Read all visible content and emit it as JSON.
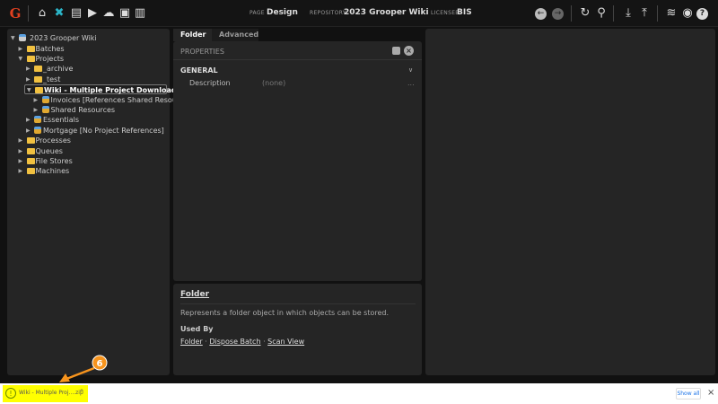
{
  "header": {
    "page_label": "PAGE",
    "page": "Design",
    "repo_label": "REPOSITORY",
    "repo": "2023 Grooper Wiki",
    "licensee_label": "LICENSEE",
    "licensee": "BIS",
    "icons": [
      "grooper-logo-icon",
      "home-icon",
      "design-tools-icon",
      "batches-icon",
      "tasks-icon",
      "cloud-upload-icon",
      "jobs-icon",
      "stats-icon",
      "back-icon",
      "forward-icon",
      "refresh-icon",
      "search-icon",
      "download-icon",
      "upload-icon",
      "database-icon",
      "user-icon",
      "help-icon"
    ]
  },
  "tree": {
    "root": "2023 Grooper Wiki",
    "items": [
      {
        "label": "Batches"
      },
      {
        "label": "Projects"
      },
      {
        "label": "_archive"
      },
      {
        "label": "_test"
      },
      {
        "label": "Wiki - Multiple Project Download"
      },
      {
        "label": "Invoices [References Shared Resources]"
      },
      {
        "label": "Shared Resources"
      },
      {
        "label": "Essentials"
      },
      {
        "label": "Mortgage [No Project References]"
      },
      {
        "label": "Processes"
      },
      {
        "label": "Queues"
      },
      {
        "label": "File Stores"
      },
      {
        "label": "Machines"
      }
    ]
  },
  "tabs": [
    {
      "label": "Folder"
    },
    {
      "label": "Advanced"
    }
  ],
  "properties": {
    "title": "PROPERTIES",
    "section": "GENERAL",
    "rows": [
      {
        "name": "Description",
        "value": "(none)",
        "more": "..."
      }
    ]
  },
  "help": {
    "title": "Folder",
    "description": "Represents a folder object in which objects can be stored.",
    "used_by_label": "Used By",
    "links": [
      "Folder",
      "Dispose Batch",
      "Scan View"
    ],
    "sep": "·"
  },
  "download": {
    "file": "Wiki - Multiple Proj....zip",
    "show_all": "Show all",
    "close": "×",
    "caret": "^"
  },
  "annotation": {
    "number": "6",
    "color": "#f7941d"
  },
  "colors": {
    "accent": "#2bb5c8",
    "highlight": "#ffff00"
  }
}
